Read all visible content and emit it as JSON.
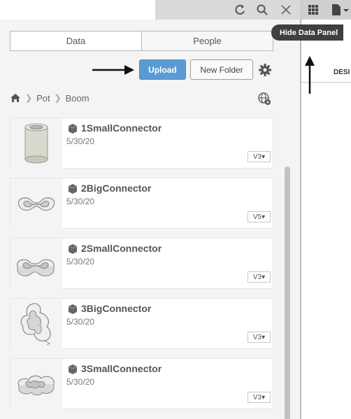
{
  "toolbar": {
    "icons": [
      "refresh-icon",
      "search-icon",
      "close-icon",
      "grid-icon",
      "file-dropdown-icon"
    ]
  },
  "tabs": [
    {
      "label": "Data",
      "active": true
    },
    {
      "label": "People",
      "active": false
    }
  ],
  "actions": {
    "upload_label": "Upload",
    "new_folder_label": "New Folder"
  },
  "breadcrumb": {
    "items": [
      "Pot",
      "Boom"
    ]
  },
  "items": [
    {
      "name": "1SmallConnector",
      "date": "5/30/20",
      "version": "V3"
    },
    {
      "name": "2BigConnector",
      "date": "5/30/20",
      "version": "V5"
    },
    {
      "name": "2SmallConnector",
      "date": "5/30/20",
      "version": "V3"
    },
    {
      "name": "3BigConnector",
      "date": "5/30/20",
      "version": "V3"
    },
    {
      "name": "3SmallConnector",
      "date": "5/30/20",
      "version": "V3"
    }
  ],
  "tooltip": {
    "text": "Hide Data Panel"
  },
  "design_column": {
    "header": "DESI"
  },
  "colors": {
    "accent": "#5b9bd5",
    "tooltip_bg": "#3f3f3f",
    "panel_bg": "#f4f4f4"
  }
}
